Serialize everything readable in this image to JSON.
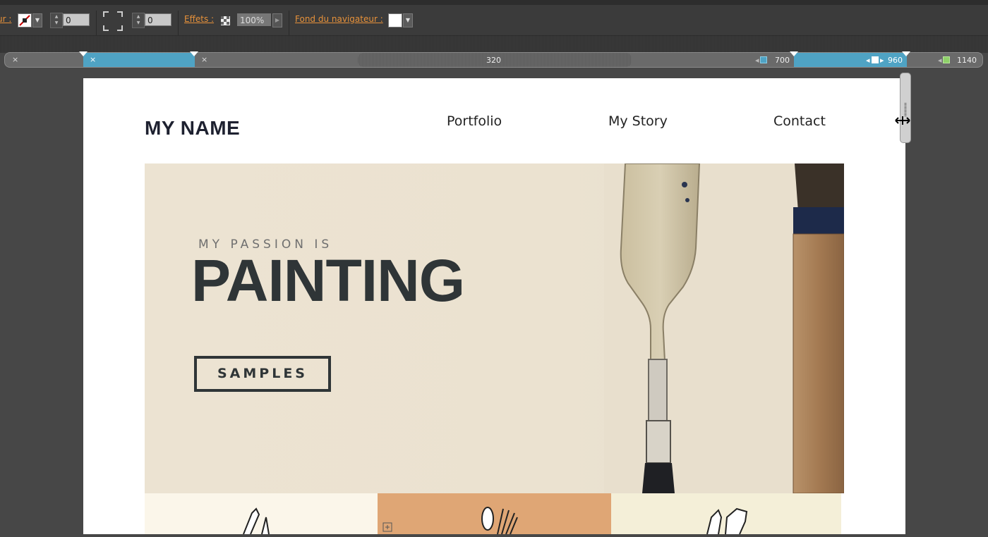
{
  "toolbar": {
    "stroke_label": "ur :",
    "stroke_width": "0",
    "radius_value": "0",
    "effects_label": "Effets :",
    "opacity_value": "100%",
    "browser_bg_label": "Fond du navigateur :"
  },
  "breakpoints": {
    "center_value": "320",
    "items": [
      {
        "label": "700"
      },
      {
        "label": "960"
      },
      {
        "label": "1140"
      }
    ],
    "colors": {
      "active": "#4fa3c4",
      "icon_1140": "#8fd16a",
      "icon_700": "#4fa3c4"
    }
  },
  "page": {
    "logo": "MY NAME",
    "nav": [
      "Portfolio",
      "My Story",
      "Contact"
    ],
    "hero": {
      "pretitle": "MY PASSION IS",
      "title": "PAINTING",
      "button": "SAMPLES"
    },
    "tiles": [
      {
        "color": "#fbf6ea",
        "icon": "pen-brush-icon"
      },
      {
        "color": "#dfa675",
        "icon": "brush-icon"
      },
      {
        "color": "#f4efd8",
        "icon": "marker-icon"
      }
    ]
  }
}
